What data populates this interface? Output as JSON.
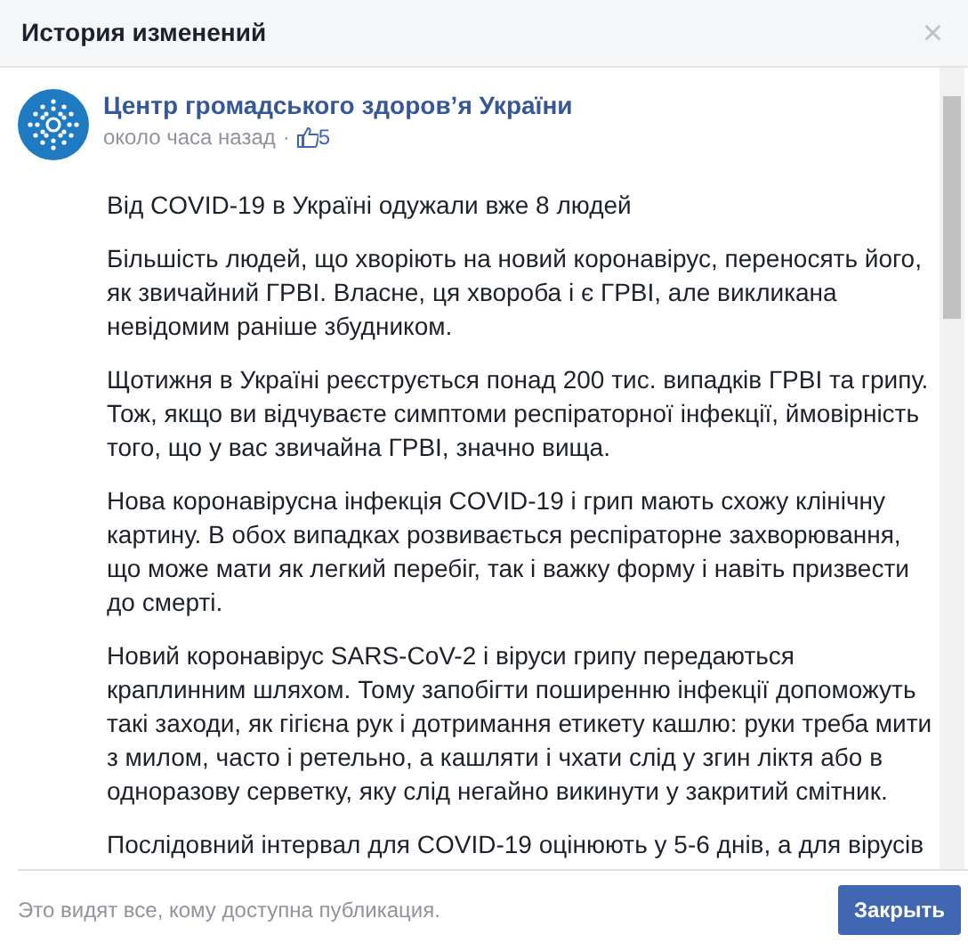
{
  "dialog": {
    "title": "История изменений",
    "close": "×"
  },
  "post": {
    "author": "Центр громадського здоров’я України",
    "time": "около часа назад",
    "separator": "·",
    "likes": "5",
    "paragraphs": [
      "Від COVID-19 в Україні одужали вже 8 людей",
      "Більшість людей, що хворіють на новий коронавірус, переносять його, як звичайний ГРВІ. Власне, ця хвороба і є ГРВІ, але викликана невідомим раніше збудником.",
      "Щотижня в Україні реєструється понад 200 тис. випадків ГРВІ та грипу. Тож, якщо ви відчуваєте симптоми респіраторної інфекції, ймовірність того, що у вас звичайна ГРВІ, значно вища.",
      "Нова коронавірусна інфекція COVID-19 і грип мають схожу клінічну картину. В обох випадках розвивається респіраторне захворювання, що може мати як легкий перебіг, так і важку форму і навіть призвести до смерті.",
      "Новий коронавірус SARS-CoV-2 і віруси грипу передаються краплинним шляхом. Тому запобігти поширенню інфекції допоможуть такі заходи, як гігієна рук і дотримання етикету кашлю: руки треба мити з милом, часто і ретельно, а кашляти і чхати слід у згин ліктя або в одноразову серветку, яку слід негайно викинути у закритий смітник.",
      "Послідовний інтервал для COVID-19 оцінюють у 5-6 днів, а для вірусів"
    ]
  },
  "footer": {
    "note": "Это видят все, кому доступна публикация.",
    "button": "Закрыть"
  }
}
